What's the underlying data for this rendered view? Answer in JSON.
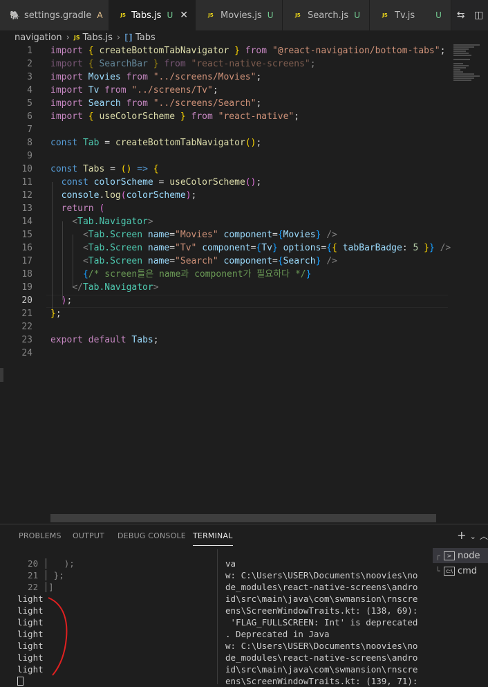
{
  "tabs": [
    {
      "label": "settings.gradle",
      "badge": "A",
      "icon": "gradle-icon"
    },
    {
      "label": "Tabs.js",
      "badge": "U",
      "icon": "js-icon",
      "active": true
    },
    {
      "label": "Movies.js",
      "badge": "U",
      "icon": "js-icon"
    },
    {
      "label": "Search.js",
      "badge": "U",
      "icon": "js-icon"
    },
    {
      "label": "Tv.js",
      "badge": "U",
      "icon": "js-icon"
    }
  ],
  "breadcrumb": {
    "folder": "navigation",
    "file": "Tabs.js",
    "symbol": "Tabs"
  },
  "editor": {
    "line_numbers": [
      "1",
      "2",
      "3",
      "4",
      "5",
      "6",
      "7",
      "8",
      "9",
      "10",
      "11",
      "12",
      "13",
      "14",
      "15",
      "16",
      "17",
      "18",
      "19",
      "20",
      "21",
      "22",
      "23",
      "24"
    ],
    "current_line": "20",
    "lines": [
      [
        [
          "kw",
          "import"
        ],
        [
          "txt",
          " "
        ],
        [
          "br1",
          "{"
        ],
        [
          "txt",
          " "
        ],
        [
          "fn",
          "createBottomTabNavigator"
        ],
        [
          "txt",
          " "
        ],
        [
          "br1",
          "}"
        ],
        [
          "txt",
          " "
        ],
        [
          "kw",
          "from"
        ],
        [
          "txt",
          " "
        ],
        [
          "str",
          "\"@react-navigation/bottom-tabs\""
        ],
        [
          "txt",
          ";"
        ]
      ],
      [
        [
          "kw faded",
          "import"
        ],
        [
          "txt faded",
          " "
        ],
        [
          "br1 faded",
          "{"
        ],
        [
          "txt faded",
          " "
        ],
        [
          "var faded",
          "SearchBar"
        ],
        [
          "txt faded",
          " "
        ],
        [
          "br1 faded",
          "}"
        ],
        [
          "txt faded",
          " "
        ],
        [
          "kw faded",
          "from"
        ],
        [
          "txt faded",
          " "
        ],
        [
          "str faded",
          "\"react-native-screens\""
        ],
        [
          "txt faded",
          ";"
        ]
      ],
      [
        [
          "kw",
          "import"
        ],
        [
          "txt",
          " "
        ],
        [
          "var",
          "Movies"
        ],
        [
          "txt",
          " "
        ],
        [
          "kw",
          "from"
        ],
        [
          "txt",
          " "
        ],
        [
          "str",
          "\"../screens/Movies\""
        ],
        [
          "txt",
          ";"
        ]
      ],
      [
        [
          "kw",
          "import"
        ],
        [
          "txt",
          " "
        ],
        [
          "var",
          "Tv"
        ],
        [
          "txt",
          " "
        ],
        [
          "kw",
          "from"
        ],
        [
          "txt",
          " "
        ],
        [
          "str",
          "\"../screens/Tv\""
        ],
        [
          "txt",
          ";"
        ]
      ],
      [
        [
          "kw",
          "import"
        ],
        [
          "txt",
          " "
        ],
        [
          "var",
          "Search"
        ],
        [
          "txt",
          " "
        ],
        [
          "kw",
          "from"
        ],
        [
          "txt",
          " "
        ],
        [
          "str",
          "\"../screens/Search\""
        ],
        [
          "txt",
          ";"
        ]
      ],
      [
        [
          "kw",
          "import"
        ],
        [
          "txt",
          " "
        ],
        [
          "br1",
          "{"
        ],
        [
          "txt",
          " "
        ],
        [
          "fn",
          "useColorScheme"
        ],
        [
          "txt",
          " "
        ],
        [
          "br1",
          "}"
        ],
        [
          "txt",
          " "
        ],
        [
          "kw",
          "from"
        ],
        [
          "txt",
          " "
        ],
        [
          "str",
          "\"react-native\""
        ],
        [
          "txt",
          ";"
        ]
      ],
      [],
      [
        [
          "kwb",
          "const"
        ],
        [
          "txt",
          " "
        ],
        [
          "cls",
          "Tab"
        ],
        [
          "txt",
          " = "
        ],
        [
          "fn",
          "createBottomTabNavigator"
        ],
        [
          "br1",
          "()"
        ],
        [
          "txt",
          ";"
        ]
      ],
      [],
      [
        [
          "kwb",
          "const"
        ],
        [
          "txt",
          " "
        ],
        [
          "fn",
          "Tabs"
        ],
        [
          "txt",
          " = "
        ],
        [
          "br1",
          "()"
        ],
        [
          "txt",
          " "
        ],
        [
          "kwb",
          "=>"
        ],
        [
          "txt",
          " "
        ],
        [
          "br1",
          "{"
        ]
      ],
      [
        [
          "txt",
          "  "
        ],
        [
          "kwb",
          "const"
        ],
        [
          "txt",
          " "
        ],
        [
          "var",
          "colorScheme"
        ],
        [
          "txt",
          " = "
        ],
        [
          "fn",
          "useColorScheme"
        ],
        [
          "br2",
          "()"
        ],
        [
          "txt",
          ";"
        ]
      ],
      [
        [
          "txt",
          "  "
        ],
        [
          "var",
          "console"
        ],
        [
          "txt",
          "."
        ],
        [
          "fn",
          "log"
        ],
        [
          "br2",
          "("
        ],
        [
          "var",
          "colorScheme"
        ],
        [
          "br2",
          ")"
        ],
        [
          "txt",
          ";"
        ]
      ],
      [
        [
          "txt",
          "  "
        ],
        [
          "kw",
          "return"
        ],
        [
          "txt",
          " "
        ],
        [
          "br2",
          "("
        ]
      ],
      [
        [
          "txt",
          "    "
        ],
        [
          "tag",
          "<"
        ],
        [
          "cls",
          "Tab.Navigator"
        ],
        [
          "tag",
          ">"
        ]
      ],
      [
        [
          "txt",
          "      "
        ],
        [
          "tag",
          "<"
        ],
        [
          "cls",
          "Tab.Screen"
        ],
        [
          "txt",
          " "
        ],
        [
          "var",
          "name"
        ],
        [
          "txt",
          "="
        ],
        [
          "str",
          "\"Movies\""
        ],
        [
          "txt",
          " "
        ],
        [
          "var",
          "component"
        ],
        [
          "txt",
          "="
        ],
        [
          "br3",
          "{"
        ],
        [
          "var",
          "Movies"
        ],
        [
          "br3",
          "}"
        ],
        [
          "txt",
          " "
        ],
        [
          "tag",
          "/>"
        ]
      ],
      [
        [
          "txt",
          "      "
        ],
        [
          "tag",
          "<"
        ],
        [
          "cls",
          "Tab.Screen"
        ],
        [
          "txt",
          " "
        ],
        [
          "var",
          "name"
        ],
        [
          "txt",
          "="
        ],
        [
          "str",
          "\"Tv\""
        ],
        [
          "txt",
          " "
        ],
        [
          "var",
          "component"
        ],
        [
          "txt",
          "="
        ],
        [
          "br3",
          "{"
        ],
        [
          "var",
          "Tv"
        ],
        [
          "br3",
          "}"
        ],
        [
          "txt",
          " "
        ],
        [
          "var",
          "options"
        ],
        [
          "txt",
          "="
        ],
        [
          "br3",
          "{"
        ],
        [
          "br1",
          "{"
        ],
        [
          "txt",
          " "
        ],
        [
          "var",
          "tabBarBadge"
        ],
        [
          "txt",
          ": "
        ],
        [
          "num",
          "5"
        ],
        [
          "txt",
          " "
        ],
        [
          "br1",
          "}"
        ],
        [
          "br3",
          "}"
        ],
        [
          "txt",
          " "
        ],
        [
          "tag",
          "/>"
        ]
      ],
      [
        [
          "txt",
          "      "
        ],
        [
          "tag",
          "<"
        ],
        [
          "cls",
          "Tab.Screen"
        ],
        [
          "txt",
          " "
        ],
        [
          "var",
          "name"
        ],
        [
          "txt",
          "="
        ],
        [
          "str",
          "\"Search\""
        ],
        [
          "txt",
          " "
        ],
        [
          "var",
          "component"
        ],
        [
          "txt",
          "="
        ],
        [
          "br3",
          "{"
        ],
        [
          "var",
          "Search"
        ],
        [
          "br3",
          "}"
        ],
        [
          "txt",
          " "
        ],
        [
          "tag",
          "/>"
        ]
      ],
      [
        [
          "txt",
          "      "
        ],
        [
          "br3",
          "{"
        ],
        [
          "cmt",
          "/* screen들은 name과 component가 필요하다 */"
        ],
        [
          "br3",
          "}"
        ]
      ],
      [
        [
          "txt",
          "    "
        ],
        [
          "tag",
          "</"
        ],
        [
          "cls",
          "Tab.Navigator"
        ],
        [
          "tag",
          ">"
        ]
      ],
      [
        [
          "txt",
          "  "
        ],
        [
          "br2",
          ")"
        ],
        [
          "txt",
          ";"
        ]
      ],
      [
        [
          "br1",
          "}"
        ],
        [
          "txt",
          ";"
        ]
      ],
      [],
      [
        [
          "kw",
          "export"
        ],
        [
          "txt",
          " "
        ],
        [
          "kw",
          "default"
        ],
        [
          "txt",
          " "
        ],
        [
          "var",
          "Tabs"
        ],
        [
          "txt",
          ";"
        ]
      ],
      []
    ]
  },
  "panel": {
    "tabs": [
      "PROBLEMS",
      "OUTPUT",
      "DEBUG CONSOLE",
      "TERMINAL"
    ],
    "active_tab": "TERMINAL",
    "add_label": "+",
    "left_terminal": [
      "  20 │   );",
      "  21 │ };",
      "  22 │]",
      "light",
      "light",
      "light",
      "light",
      "light",
      "light",
      "light"
    ],
    "right_terminal": [
      "va",
      "w: C:\\Users\\USER\\Documents\\noovies\\no",
      "de_modules\\react-native-screens\\andro",
      "id\\src\\main\\java\\com\\swmansion\\rnscre",
      "ens\\ScreenWindowTraits.kt: (138, 69):",
      " 'FLAG_FULLSCREEN: Int' is deprecated",
      ". Deprecated in Java",
      "w: C:\\Users\\USER\\Documents\\noovies\\no",
      "de_modules\\react-native-screens\\andro",
      "id\\src\\main\\java\\com\\swmansion\\rnscre",
      "ens\\ScreenWindowTraits.kt: (139, 71):"
    ],
    "terminals": [
      {
        "label": "node",
        "icon": "terminal-icon",
        "selected": true
      },
      {
        "label": "cmd",
        "icon": "cmd-icon",
        "selected": false
      }
    ]
  },
  "colors": {
    "accent": "#007acc",
    "annotation": "#e02020"
  }
}
